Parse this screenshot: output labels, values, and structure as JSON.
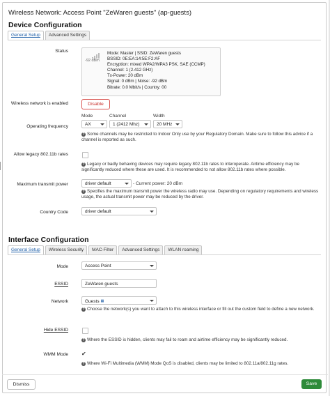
{
  "dialog_title": "Wireless Network: Access Point \"ZeWaren guests\" (ap-guests)",
  "device": {
    "section_title": "Device Configuration",
    "tabs": [
      "General Setup",
      "Advanced Settings"
    ],
    "status": {
      "label": "Status",
      "signal_text": "-92 dBm",
      "mode_line": "Mode: Master | SSID: ZeWaren guests",
      "bssid_line": "BSSID: 0E:EA:14:5E:F2:AF",
      "encryption_line": "Encryption: mixed WPA2/WPA3 PSK, SAE (CCMP)",
      "channel_line": "Channel: 1 (2.412 GHz)",
      "txpower_line": "Tx-Power: 20 dBm",
      "signal_line": "Signal: 0 dBm | Noise: -92 dBm",
      "bitrate_line": "Bitrate: 0.0 Mbit/s | Country: 00"
    },
    "enabled": {
      "label": "Wireless network is enabled",
      "button": "Disable"
    },
    "frequency": {
      "label": "Operating frequency",
      "mode_label": "Mode",
      "mode_value": "AX",
      "channel_label": "Channel",
      "channel_value": "1 (2412 Mhz)",
      "width_label": "Width",
      "width_value": "20 MHz",
      "help": "Some channels may be restricted to Indoor Only use by your Regulatory Domain. Make sure to follow this advice if a channel is reported as such."
    },
    "legacy": {
      "label": "Allow legacy 802.11b rates",
      "help": "Legacy or badly behaving devices may require legacy 802.11b rates to interoperate. Airtime efficiency may be significantly reduced where these are used. It is recommended to not allow 802.11b rates where possible."
    },
    "txpower": {
      "label": "Maximum transmit power",
      "value": "driver default",
      "current": "- Current power: 20 dBm",
      "help": "Specifies the maximum transmit power the wireless radio may use. Depending on regulatory requirements and wireless usage, the actual transmit power may be reduced by the driver."
    },
    "country": {
      "label": "Country Code",
      "value": "driver default"
    }
  },
  "interface": {
    "section_title": "Interface Configuration",
    "tabs": [
      "General Setup",
      "Wireless Security",
      "MAC-Filter",
      "Advanced Settings",
      "WLAN roaming"
    ],
    "mode": {
      "label": "Mode",
      "value": "Access Point"
    },
    "essid": {
      "label": "ESSID",
      "value": "ZeWaren guests"
    },
    "network": {
      "label": "Network",
      "value": "Guests",
      "help": "Choose the network(s) you want to attach to this wireless interface or fill out the custom field to define a new network."
    },
    "hide_essid": {
      "label": "Hide ESSID",
      "help": "Where the ESSID is hidden, clients may fail to roam and airtime efficiency may be significantly reduced."
    },
    "wmm": {
      "label": "WMM Mode",
      "help": "Where Wi-Fi Multimedia (WMM) Mode QoS is disabled, clients may be limited to 802.11a/802.11g rates."
    }
  },
  "footer": {
    "dismiss": "Dismiss",
    "save": "Save"
  },
  "colors": {
    "accent": "#1f5fa8",
    "save": "#2e8b3a",
    "danger": "#c9302c"
  },
  "icons": {
    "help": "help-icon",
    "signal": "signal-icon",
    "network": "network-icon",
    "check": "check-icon"
  }
}
